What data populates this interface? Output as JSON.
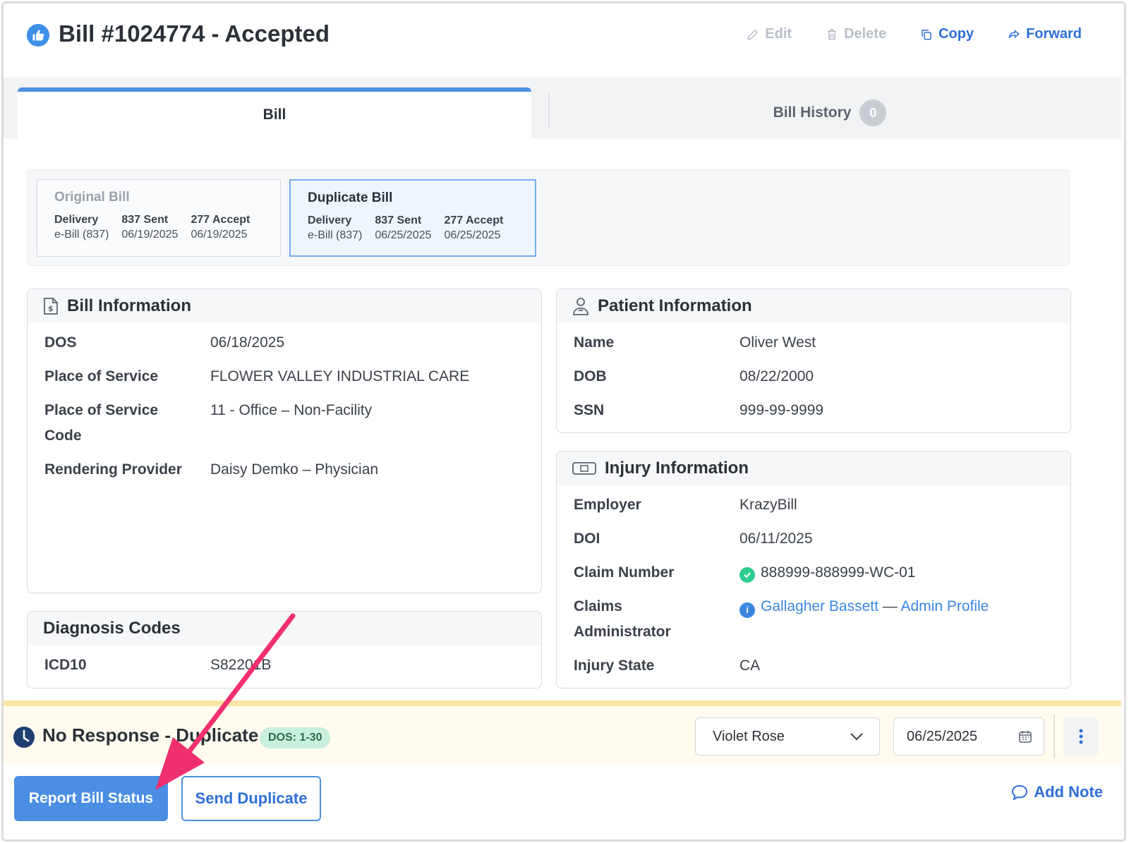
{
  "header": {
    "title": "Bill #1024774 - Accepted",
    "title_icon": "thumbs-up-icon",
    "actions": [
      {
        "label": "Edit",
        "icon": "pencil-icon",
        "enabled": false
      },
      {
        "label": "Delete",
        "icon": "trash-icon",
        "enabled": false
      },
      {
        "label": "Copy",
        "icon": "copy-icon",
        "enabled": true
      },
      {
        "label": "Forward",
        "icon": "forward-icon",
        "enabled": true
      }
    ]
  },
  "tabs": {
    "bill": "Bill",
    "history": "Bill History",
    "history_count": "0"
  },
  "versions": [
    {
      "title": "Original Bill",
      "delivery_h": "Delivery",
      "delivery_v": "e-Bill (837)",
      "sent_h": "837 Sent",
      "sent_v": "06/19/2025",
      "accept_h": "277 Accept",
      "accept_v": "06/19/2025"
    },
    {
      "title": "Duplicate Bill",
      "delivery_h": "Delivery",
      "delivery_v": "e-Bill (837)",
      "sent_h": "837 Sent",
      "sent_v": "06/25/2025",
      "accept_h": "277 Accept",
      "accept_v": "06/25/2025"
    }
  ],
  "bill_info": {
    "heading": "Bill Information",
    "rows": [
      {
        "label": "DOS",
        "value": "06/18/2025"
      },
      {
        "label": "Place of Service",
        "value": "FLOWER VALLEY INDUSTRIAL CARE"
      },
      {
        "label": "Place of Service Code",
        "value": "11 - Office – Non-Facility"
      },
      {
        "label": "Rendering Provider",
        "value": "Daisy Demko – Physician"
      }
    ]
  },
  "diagnosis": {
    "heading": "Diagnosis Codes",
    "label": "ICD10",
    "value": "S82201B"
  },
  "patient_info": {
    "heading": "Patient Information",
    "rows": [
      {
        "label": "Name",
        "value": "Oliver West"
      },
      {
        "label": "DOB",
        "value": "08/22/2000"
      },
      {
        "label": "SSN",
        "value": "999-99-9999"
      }
    ]
  },
  "injury_info": {
    "heading": "Injury Information",
    "employer_label": "Employer",
    "employer": "KrazyBill",
    "doi_label": "DOI",
    "doi": "06/11/2025",
    "claim_label": "Claim Number",
    "claim": "888999-888999-WC-01",
    "admin_label": "Claims Administrator",
    "admin_name": "Gallagher Bassett",
    "admin_sep": "—",
    "admin_profile": "Admin Profile",
    "state_label": "Injury State",
    "state": "CA"
  },
  "status": {
    "text": "No Response - Duplicate",
    "pill": "DOS: 1-30",
    "assignee": "Violet Rose",
    "date": "06/25/2025"
  },
  "buttons": {
    "report": "Report Bill Status",
    "send_duplicate": "Send Duplicate",
    "add_note": "Add Note"
  },
  "colors": {
    "accent": "#4a8fe3",
    "arrow": "#f0306e",
    "status_bg": "#fffbee",
    "success": "#2ecc8f"
  }
}
